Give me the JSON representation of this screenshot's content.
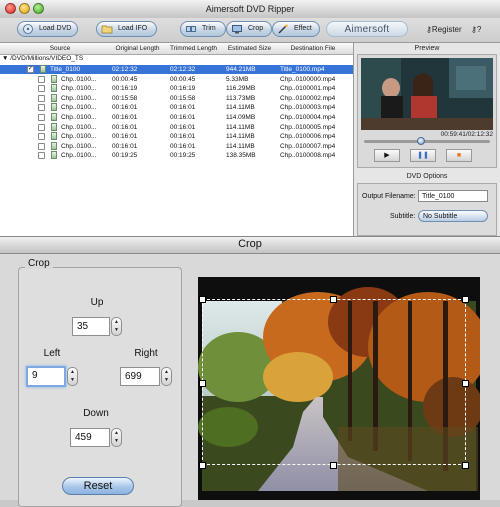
{
  "app": {
    "title": "Aimersoft DVD Ripper",
    "logo": "Aimersoft"
  },
  "toolbar": {
    "load_dvd": "Load DVD",
    "load_ifo": "Load IFO",
    "trim": "Trim",
    "crop": "Crop",
    "effect": "Effect",
    "register": "Register",
    "help": "?"
  },
  "table": {
    "headers": [
      "Source",
      "Original Length",
      "Trimmed Length",
      "Estimated Size",
      "Destination File"
    ],
    "path": "/DVD/Millions/VIDEO_TS",
    "rows": [
      {
        "source": "Title_0100",
        "original": "02:12:32",
        "trimmed": "02:12:32",
        "size": "944.21MB",
        "dest": "Title_0100.mp4"
      },
      {
        "source": "Chp..0100...",
        "original": "00:00:45",
        "trimmed": "00:00:45",
        "size": "5.33MB",
        "dest": "Chp..0100000.mp4"
      },
      {
        "source": "Chp..0100...",
        "original": "00:16:19",
        "trimmed": "00:16:19",
        "size": "116.29MB",
        "dest": "Chp..0100001.mp4"
      },
      {
        "source": "Chp..0100...",
        "original": "00:15:58",
        "trimmed": "00:15:58",
        "size": "113.73MB",
        "dest": "Chp..0100002.mp4"
      },
      {
        "source": "Chp..0100...",
        "original": "00:16:01",
        "trimmed": "00:16:01",
        "size": "114.11MB",
        "dest": "Chp..0100003.mp4"
      },
      {
        "source": "Chp..0100...",
        "original": "00:16:01",
        "trimmed": "00:16:01",
        "size": "114.09MB",
        "dest": "Chp..0100004.mp4"
      },
      {
        "source": "Chp..0100...",
        "original": "00:16:01",
        "trimmed": "00:16:01",
        "size": "114.11MB",
        "dest": "Chp..0100005.mp4"
      },
      {
        "source": "Chp..0100...",
        "original": "00:16:01",
        "trimmed": "00:16:01",
        "size": "114.11MB",
        "dest": "Chp..0100006.mp4"
      },
      {
        "source": "Chp..0100...",
        "original": "00:16:01",
        "trimmed": "00:16:01",
        "size": "114.11MB",
        "dest": "Chp..0100007.mp4"
      },
      {
        "source": "Chp..0100...",
        "original": "00:19:25",
        "trimmed": "00:19:25",
        "size": "138.35MB",
        "dest": "Chp..0100008.mp4"
      }
    ]
  },
  "preview": {
    "title": "Preview",
    "timecode": "00:59:41/02:12:32",
    "progress": 0.45
  },
  "dvd_options": {
    "title": "DVD Options",
    "output_label": "Output Filename:",
    "output_value": "Title_0100",
    "subtitle_label": "Subtitle:",
    "subtitle_value": "No Subtitle"
  },
  "crop": {
    "window_title": "Crop",
    "group_label": "Crop",
    "up_label": "Up",
    "up_value": "35",
    "left_label": "Left",
    "left_value": "9",
    "right_label": "Right",
    "right_value": "699",
    "down_label": "Down",
    "down_value": "459",
    "reset_label": "Reset"
  },
  "colors": {
    "selection": "#3874d8",
    "button_blue": "#a9c6e8",
    "focus_ring": "#7fa9e3"
  }
}
